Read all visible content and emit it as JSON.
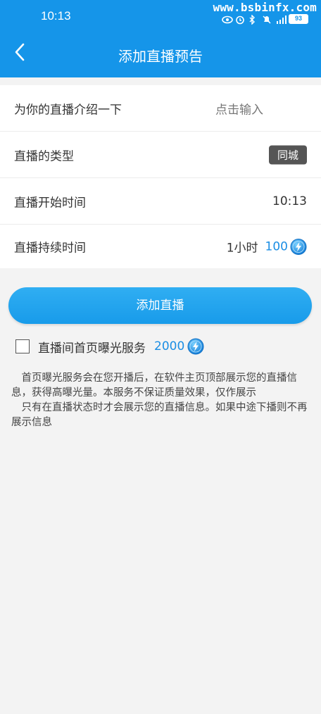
{
  "status_bar": {
    "time": "10:13",
    "watermark": "www.bsbinfx.com",
    "battery": "93",
    "icons": [
      "eye-icon",
      "alarm-icon",
      "bluetooth-icon",
      "mute-icon",
      "signal-5g-icon",
      "battery-icon"
    ]
  },
  "header": {
    "title": "添加直播预告",
    "back_icon": "back-arrow-icon"
  },
  "form": {
    "intro": {
      "label": "为你的直播介绍一下",
      "placeholder": "点击输入"
    },
    "type": {
      "label": "直播的类型",
      "value": "同城"
    },
    "start_time": {
      "label": "直播开始时间",
      "value": "10:13"
    },
    "duration": {
      "label": "直播持续时间",
      "value": "1小时",
      "price": "100",
      "price_icon": "coin-icon"
    }
  },
  "submit_label": "添加直播",
  "service": {
    "checked": false,
    "label": "直播间首页曝光服务",
    "price": "2000",
    "price_icon": "coin-icon"
  },
  "info": {
    "line1": "首页曝光服务会在您开播后，在软件主页顶部展示您的直播信息，获得高曝光量。本服务不保证质量效果，仅作展示",
    "line2": "只有在直播状态时才会展示您的直播信息。如果中途下播则不再展示信息"
  },
  "colors": {
    "primary": "#1595e9",
    "accent_text": "#1b8ee4",
    "badge": "#555555",
    "background": "#f3f3f3"
  }
}
